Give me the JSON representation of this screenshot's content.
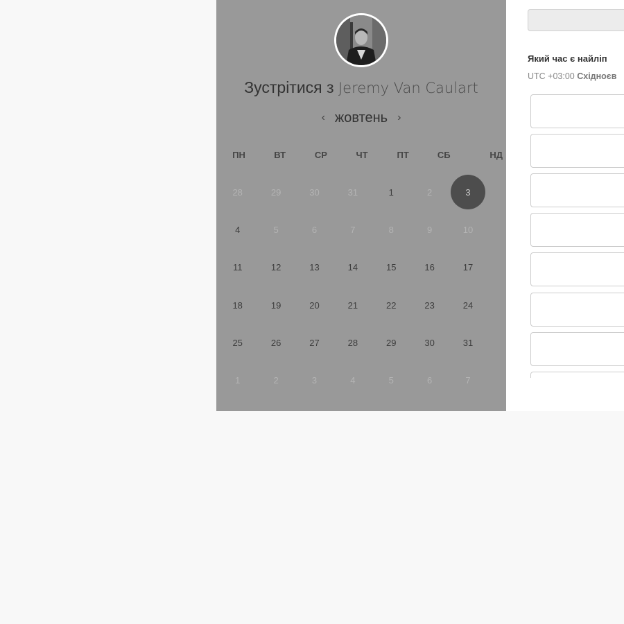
{
  "meeting": {
    "prefix": "Зустрітися з",
    "host_name": "Jeremy Van Caulart"
  },
  "calendar": {
    "month": "жовтень",
    "prev_icon": "chevron-left-icon",
    "next_icon": "chevron-right-icon",
    "weekdays": [
      "ПН",
      "ВТ",
      "СР",
      "ЧТ",
      "ПТ",
      "СБ",
      "НД"
    ],
    "days": [
      {
        "label": "28",
        "muted": true
      },
      {
        "label": "29",
        "muted": true
      },
      {
        "label": "30",
        "muted": true
      },
      {
        "label": "31",
        "muted": true
      },
      {
        "label": "1",
        "muted": false
      },
      {
        "label": "2",
        "muted": true
      },
      {
        "label": "3",
        "muted": false,
        "selected": true
      },
      {
        "label": "4",
        "muted": false
      },
      {
        "label": "5",
        "muted": true
      },
      {
        "label": "6",
        "muted": true
      },
      {
        "label": "7",
        "muted": true
      },
      {
        "label": "8",
        "muted": true
      },
      {
        "label": "9",
        "muted": true
      },
      {
        "label": "10",
        "muted": true
      },
      {
        "label": "11",
        "muted": false
      },
      {
        "label": "12",
        "muted": false
      },
      {
        "label": "13",
        "muted": false
      },
      {
        "label": "14",
        "muted": false
      },
      {
        "label": "15",
        "muted": false
      },
      {
        "label": "16",
        "muted": false
      },
      {
        "label": "17",
        "muted": false
      },
      {
        "label": "18",
        "muted": false
      },
      {
        "label": "19",
        "muted": false
      },
      {
        "label": "20",
        "muted": false
      },
      {
        "label": "21",
        "muted": false
      },
      {
        "label": "22",
        "muted": false
      },
      {
        "label": "23",
        "muted": false
      },
      {
        "label": "24",
        "muted": false
      },
      {
        "label": "25",
        "muted": false
      },
      {
        "label": "26",
        "muted": false
      },
      {
        "label": "27",
        "muted": false
      },
      {
        "label": "28",
        "muted": false
      },
      {
        "label": "29",
        "muted": false
      },
      {
        "label": "30",
        "muted": false
      },
      {
        "label": "31",
        "muted": false
      },
      {
        "label": "1",
        "muted": true
      },
      {
        "label": "2",
        "muted": true
      },
      {
        "label": "3",
        "muted": true
      },
      {
        "label": "4",
        "muted": true
      },
      {
        "label": "5",
        "muted": true
      },
      {
        "label": "6",
        "muted": true
      },
      {
        "label": "7",
        "muted": true
      }
    ]
  },
  "times_panel": {
    "question": "Який час є найліп",
    "utc_offset": "UTC +03:00",
    "zone_name": "Східноєв",
    "slot_count_visible": 8
  },
  "colors": {
    "overlay": "#999999",
    "selected_day": "#4d4d4d",
    "page_background": "#f8f8f8"
  }
}
